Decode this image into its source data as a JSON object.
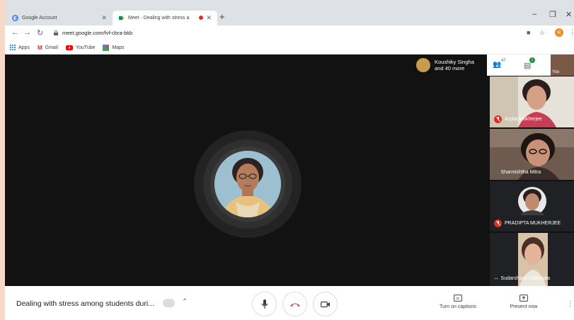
{
  "browser": {
    "tabs": [
      {
        "title": "Google Account"
      },
      {
        "title": "Meet - Dealing with stress a"
      }
    ],
    "new_tab": "+",
    "url": "meet.google.com/fvf-cbra-bkb",
    "profile_initial": "R",
    "bookmarks": [
      "Apps",
      "Gmail",
      "YouTube",
      "Maps"
    ]
  },
  "meet": {
    "header_participants": {
      "line1": "Koushiky Singha",
      "line2": "and 40 more"
    },
    "people_count": "47",
    "chat_badge": "1",
    "self_label": "You",
    "tiles": [
      {
        "name": "Arpita Mukherjee",
        "muted": true
      },
      {
        "name": "Sharmishtha Mitra",
        "muted": false
      },
      {
        "name": "PRADIPTA MUKHERJEE",
        "muted": true
      },
      {
        "name": "Sudarshana Dasgupta",
        "muted": false
      }
    ],
    "meeting_title": "Dealing with stress among students duri...",
    "actions": {
      "captions": "Turn on captions",
      "present": "Present now"
    }
  },
  "colors": {
    "stage": "#121212",
    "end_call": "#d93025",
    "accent": "#1a73e8"
  }
}
